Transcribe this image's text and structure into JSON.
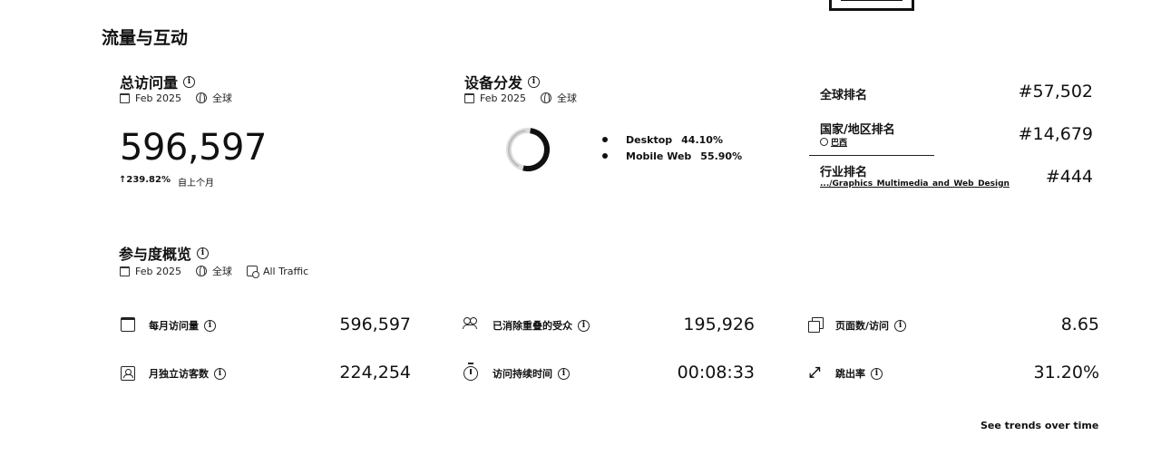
{
  "section": {
    "title": "流量与互动"
  },
  "visits_card": {
    "title": "总访问量",
    "date": "Feb 2025",
    "region": "全球",
    "value": "596,597",
    "change_pct": "↑239.82%",
    "change_label": "自上个月"
  },
  "device_card": {
    "title": "设备分发",
    "date": "Feb 2025",
    "region": "全球",
    "legend": [
      {
        "name": "Desktop",
        "value": "44.10%"
      },
      {
        "name": "Mobile Web",
        "value": "55.90%"
      }
    ],
    "share": {
      "desktop": 44.1,
      "mobile_web": 55.9
    }
  },
  "rankings": {
    "global_label": "全球排名",
    "global_value": "#57,502",
    "country_label": "国家/地区排名",
    "country_name": "巴西",
    "country_value": "#14,679",
    "industry_label": "行业排名",
    "industry_path": ".../Graphics_Multimedia_and_Web_Design",
    "industry_value": "#444"
  },
  "engagement": {
    "title": "参与度概览",
    "date": "Feb 2025",
    "region": "全球",
    "traffic": "All Traffic",
    "metrics": [
      {
        "label": "每月访问量",
        "value": "596,597",
        "icon": "calendar-icon"
      },
      {
        "label": "月独立访客数",
        "value": "224,254",
        "icon": "person-icon"
      },
      {
        "label": "已消除重叠的受众",
        "value": "195,926",
        "icon": "users-icon"
      },
      {
        "label": "访问持续时间",
        "value": "00:08:33",
        "icon": "timer-icon"
      },
      {
        "label": "页面数/访问",
        "value": "8.65",
        "icon": "pages-icon"
      },
      {
        "label": "跳出率",
        "value": "31.20%",
        "icon": "bounce-icon"
      }
    ]
  },
  "footer": {
    "trends_link": "See trends over time"
  }
}
